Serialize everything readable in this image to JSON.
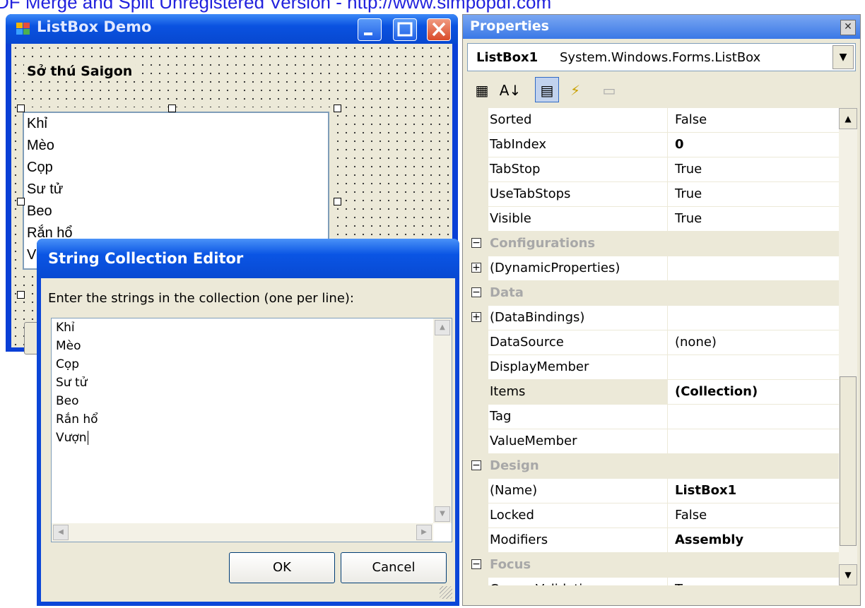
{
  "watermark": "DF Merge and Split Unregistered Version - http://www.simpopdf.com",
  "listbox_window": {
    "title": "ListBox Demo",
    "label": "Sở thú Saigon",
    "items": [
      "Khỉ",
      "Mèo",
      "Cọp",
      "Sư tử",
      "Beo",
      "Rắn hổ",
      "V"
    ]
  },
  "properties": {
    "title": "Properties",
    "close_glyph": "✕",
    "object_name": "ListBox1",
    "object_type": "System.Windows.Forms.ListBox",
    "toolbar": [
      {
        "icon": "categorized-icon",
        "glyph": "▦"
      },
      {
        "icon": "alphabetical-icon",
        "glyph": "A↓"
      },
      {
        "icon": "properties-icon",
        "glyph": "▤"
      },
      {
        "icon": "events-icon",
        "glyph": "⚡"
      },
      {
        "icon": "property-pages-icon",
        "glyph": "▭"
      }
    ],
    "rows": [
      {
        "kind": "prop",
        "name": "Sorted",
        "value": "False"
      },
      {
        "kind": "prop",
        "name": "TabIndex",
        "value": "0",
        "bold": true
      },
      {
        "kind": "prop",
        "name": "TabStop",
        "value": "True"
      },
      {
        "kind": "prop",
        "name": "UseTabStops",
        "value": "True"
      },
      {
        "kind": "prop",
        "name": "Visible",
        "value": "True"
      },
      {
        "kind": "cat",
        "name": "Configurations"
      },
      {
        "kind": "expand",
        "name": "(DynamicProperties)",
        "value": ""
      },
      {
        "kind": "cat",
        "name": "Data"
      },
      {
        "kind": "expand",
        "name": "(DataBindings)",
        "value": ""
      },
      {
        "kind": "prop",
        "name": "DataSource",
        "value": "(none)"
      },
      {
        "kind": "prop",
        "name": "DisplayMember",
        "value": ""
      },
      {
        "kind": "prop",
        "name": "Items",
        "value": "(Collection)",
        "bold": true,
        "selected": true
      },
      {
        "kind": "prop",
        "name": "Tag",
        "value": ""
      },
      {
        "kind": "prop",
        "name": "ValueMember",
        "value": ""
      },
      {
        "kind": "cat",
        "name": "Design"
      },
      {
        "kind": "prop",
        "name": "(Name)",
        "value": "ListBox1",
        "bold": true
      },
      {
        "kind": "prop",
        "name": "Locked",
        "value": "False"
      },
      {
        "kind": "prop",
        "name": "Modifiers",
        "value": "Assembly",
        "bold": true
      },
      {
        "kind": "cat",
        "name": "Focus"
      },
      {
        "kind": "prop",
        "name": "CausesValidation",
        "value": "True"
      }
    ]
  },
  "editor": {
    "title": "String Collection Editor",
    "prompt": "Enter the strings in the collection (one per line):",
    "lines": [
      "Khỉ",
      "Mèo",
      "Cọp",
      "Sư tử",
      "Beo",
      "Rắn hổ",
      "Vượn"
    ],
    "ok_label": "OK",
    "cancel_label": "Cancel"
  }
}
